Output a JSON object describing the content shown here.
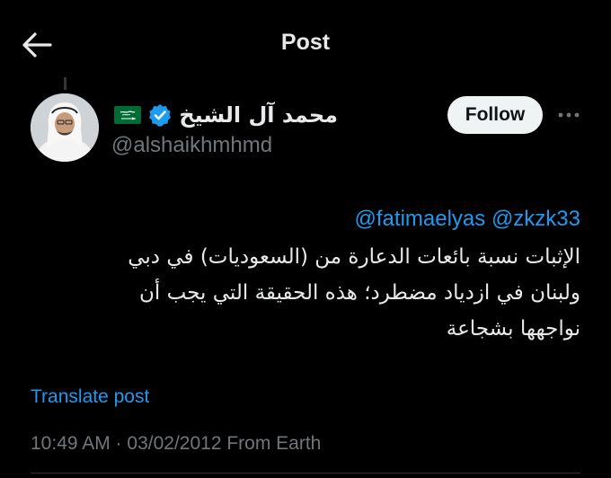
{
  "header": {
    "title": "Post",
    "back_icon": "arrow-left-icon"
  },
  "author": {
    "display_name": "محمد آل الشيخ",
    "handle": "@alshaikhmhmd",
    "verified": true,
    "verified_icon": "verified-badge-icon",
    "flag_icon": "saudi-flag-icon",
    "follow_label": "Follow",
    "more_icon": "more-horizontal-icon"
  },
  "post": {
    "mentions": [
      "@fatimaelyas",
      "@zkzk33"
    ],
    "lines": [
      "الإثبات نسبة بائعات الدعارة من (السعوديات) في دبي",
      "ولبنان في ازدياد مضطرد؛ هذه الحقيقة التي يجب أن",
      "نواجهها بشجاعة"
    ],
    "translate_label": "Translate post",
    "meta": "10:49 AM · 03/02/2012 From Earth"
  },
  "colors": {
    "background": "#000000",
    "text": "#e7e9ea",
    "secondary": "#71767b",
    "link": "#1d9bf0",
    "follow_bg": "#eff3f4",
    "flag_green": "#006c35"
  }
}
